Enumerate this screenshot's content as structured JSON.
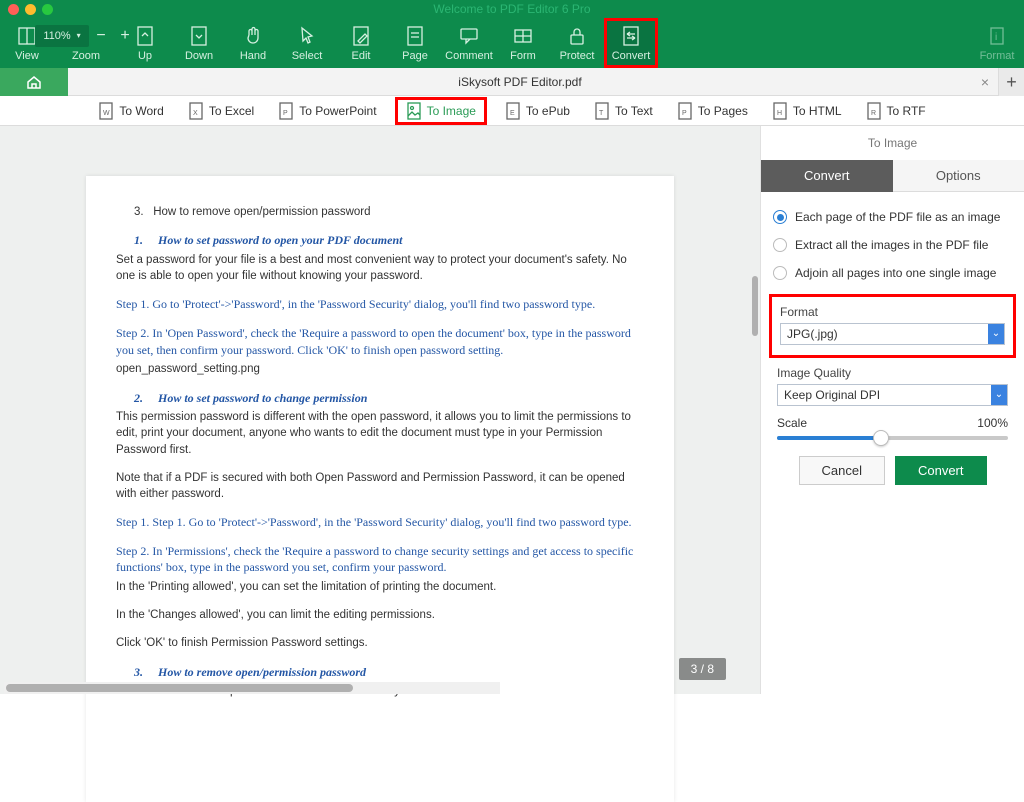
{
  "window": {
    "title": "Welcome to PDF Editor 6 Pro"
  },
  "toolbar": {
    "view": "View",
    "zoom": "Zoom",
    "zoomVal": "110%",
    "up": "Up",
    "down": "Down",
    "hand": "Hand",
    "select": "Select",
    "edit": "Edit",
    "page": "Page",
    "comment": "Comment",
    "form": "Form",
    "protect": "Protect",
    "convert": "Convert",
    "format": "Format"
  },
  "tab": {
    "home": "home",
    "docname": "iSkysoft PDF Editor.pdf"
  },
  "subtool": {
    "word": "To Word",
    "excel": "To Excel",
    "ppt": "To PowerPoint",
    "image": "To Image",
    "epub": "To ePub",
    "text": "To Text",
    "pages": "To Pages",
    "html": "To HTML",
    "rtf": "To RTF"
  },
  "page": {
    "li3": "How to remove open/permission password",
    "s1num": "1.",
    "s1t": "How to set password to open your PDF document",
    "s1p": "Set a password for your file is a best and most convenient way to protect your document's safety. No one is able to open your file without knowing your password.",
    "s1step1": "Step 1. Go to 'Protect'->'Password', in the 'Password Security' dialog, you'll find two password type.",
    "s1step2": "Step 2. In 'Open Password', check the 'Require a password to open the document' box, type in the password you set, then confirm your password. Click 'OK' to finish open password setting.",
    "s1img": "open_password_setting.png",
    "s2num": "2.",
    "s2t": "How to set password to change permission",
    "s2p": "This permission password is different with the open password, it allows you to limit the permissions to edit, print your document, anyone who wants to edit the document must type in your Permission Password first.",
    "s2note": "Note that if a PDF is secured with both Open Password and Permission Password, it can be opened with either password.",
    "s2step1": "Step 1. Step 1. Go to 'Protect'->'Password', in the 'Password Security' dialog, you'll find two password type.",
    "s2step2a": "Step 2. In 'Permissions', check the 'Require a password to change security settings and get access to specific functions' box, type in the password you set, confirm your password.",
    "s2step2b": "In the 'Printing allowed', you can set the limitation of printing the document.",
    "s2step2c": "In the 'Changes allowed', you can limit the editing permissions.",
    "s2step2d": "Click 'OK' to finish Permission Password settings.",
    "s3num": "3.",
    "s3t": "How to remove open/permission password",
    "s3p": "You can remove the Open/Permission Password in iSkysoft PDF Editor.",
    "pagenum": "3 / 8"
  },
  "side": {
    "title": "To Image",
    "tabConvert": "Convert",
    "tabOptions": "Options",
    "opt1": "Each page of the PDF file as an image",
    "opt2": "Extract all the images in the PDF file",
    "opt3": "Adjoin all pages into one single image",
    "formatLbl": "Format",
    "formatVal": "JPG(.jpg)",
    "qualityLbl": "Image Quality",
    "qualityVal": "Keep Original DPI",
    "scaleLbl": "Scale",
    "scaleVal": "100%",
    "cancel": "Cancel",
    "convert": "Convert"
  }
}
